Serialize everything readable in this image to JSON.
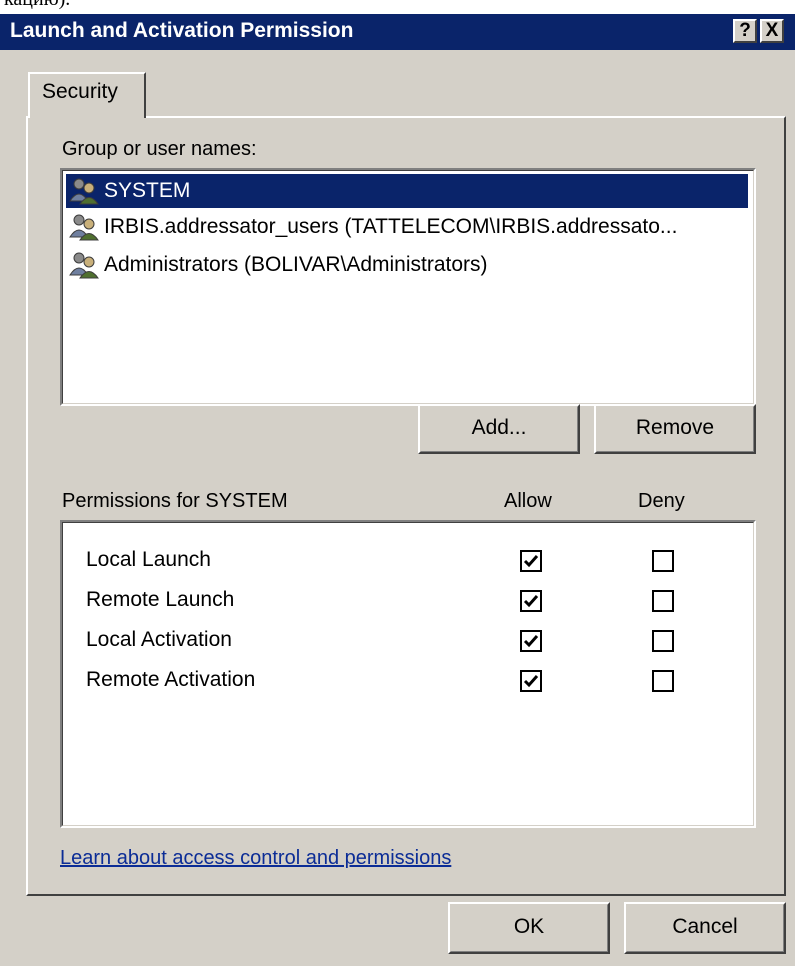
{
  "fragment_text": "кацию).",
  "window": {
    "title": "Launch and Activation Permission",
    "help_button": "?",
    "close_button": "X"
  },
  "tabs": [
    {
      "label": "Security",
      "selected": true
    }
  ],
  "security": {
    "group_label": "Group or user names:",
    "users": [
      {
        "name": "SYSTEM",
        "selected": true,
        "icon": "user-group-icon"
      },
      {
        "name": "IRBIS.addressator_users (TATTELECOM\\IRBIS.addressato...",
        "selected": false,
        "icon": "user-group-icon"
      },
      {
        "name": "Administrators (BOLIVAR\\Administrators)",
        "selected": false,
        "icon": "user-group-icon"
      }
    ],
    "add_button": "Add...",
    "remove_button": "Remove",
    "permissions_label": "Permissions for SYSTEM",
    "allow_header": "Allow",
    "deny_header": "Deny",
    "permissions": [
      {
        "name": "Local Launch",
        "allow": true,
        "deny": false
      },
      {
        "name": "Remote Launch",
        "allow": true,
        "deny": false
      },
      {
        "name": "Local Activation",
        "allow": true,
        "deny": false
      },
      {
        "name": "Remote Activation",
        "allow": true,
        "deny": false
      }
    ],
    "learn_link": "Learn about access control and permissions"
  },
  "footer": {
    "ok_button": "OK",
    "cancel_button": "Cancel"
  },
  "colors": {
    "titlebar": "#0a246a",
    "dialog_face": "#d4d0c8",
    "selection": "#0a246a",
    "link": "#0b2c96"
  }
}
